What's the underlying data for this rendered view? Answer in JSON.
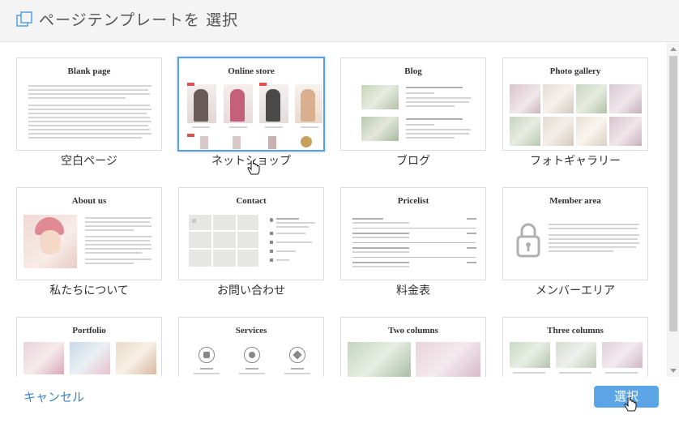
{
  "dialog": {
    "title": "ページテンプレートを 選択",
    "cancel_label": "キャンセル",
    "select_label": "選択"
  },
  "templates": [
    {
      "title": "Blank page",
      "label": "空白ページ"
    },
    {
      "title": "Online store",
      "label": "ネットショップ"
    },
    {
      "title": "Blog",
      "label": "ブログ"
    },
    {
      "title": "Photo gallery",
      "label": "フォトギャラリー"
    },
    {
      "title": "About us",
      "label": "私たちについて"
    },
    {
      "title": "Contact",
      "label": "お問い合わせ"
    },
    {
      "title": "Pricelist",
      "label": "料金表"
    },
    {
      "title": "Member area",
      "label": "メンバーエリア"
    },
    {
      "title": "Portfolio",
      "label": ""
    },
    {
      "title": "Services",
      "label": ""
    },
    {
      "title": "Two columns",
      "label": ""
    },
    {
      "title": "Three columns",
      "label": ""
    }
  ],
  "colors": {
    "accent": "#5ba5e6",
    "link": "#3a85c8",
    "selected_border": "#5aa0e0"
  }
}
